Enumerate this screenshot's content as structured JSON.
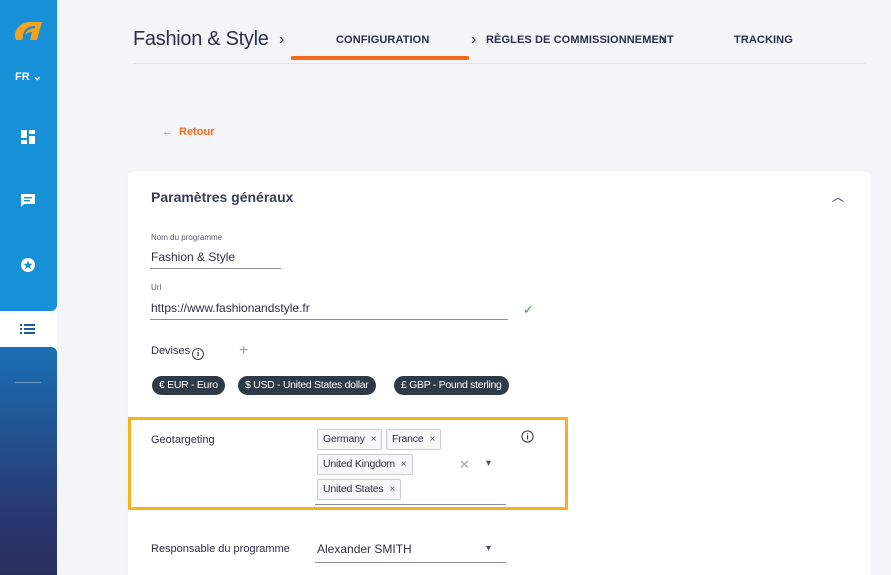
{
  "sidebar": {
    "language": "FR",
    "icons": [
      "dashboard-icon",
      "chat-icon",
      "star-badge-icon",
      "list-icon"
    ],
    "accent": "#1690d6"
  },
  "header": {
    "program_title": "Fashion & Style",
    "tabs": [
      {
        "label": "CONFIGURATION",
        "active": true
      },
      {
        "label": "RÈGLES DE COMMISSIONNEMENT",
        "active": false
      },
      {
        "label": "TRACKING",
        "active": false
      }
    ],
    "active_color": "#f26b1d"
  },
  "back": {
    "label": "Retour"
  },
  "card": {
    "title": "Paramètres généraux",
    "program_name": {
      "label": "Nom du programme",
      "value": "Fashion & Style"
    },
    "url": {
      "label": "Url",
      "value": "https://www.fashionandstyle.fr",
      "valid": true
    },
    "devises": {
      "label": "Devises",
      "items": [
        "€ EUR - Euro",
        "$ USD - United States dollar",
        "£ GBP - Pound sterling"
      ]
    },
    "geotargeting": {
      "label": "Geotargeting",
      "tags": [
        "Germany",
        "France",
        "United Kingdom",
        "United States"
      ],
      "highlight_color": "#f5b21c"
    },
    "responsable": {
      "label": "Responsable du programme",
      "value": "Alexander SMITH"
    }
  }
}
